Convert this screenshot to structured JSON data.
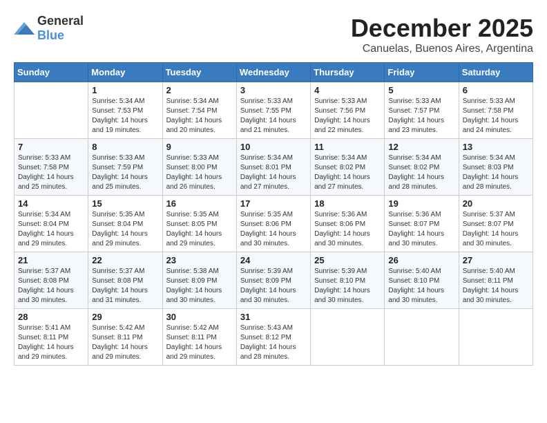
{
  "logo": {
    "general": "General",
    "blue": "Blue"
  },
  "header": {
    "month": "December 2025",
    "location": "Canuelas, Buenos Aires, Argentina"
  },
  "days_of_week": [
    "Sunday",
    "Monday",
    "Tuesday",
    "Wednesday",
    "Thursday",
    "Friday",
    "Saturday"
  ],
  "weeks": [
    [
      {
        "day": "",
        "info": ""
      },
      {
        "day": "1",
        "info": "Sunrise: 5:34 AM\nSunset: 7:53 PM\nDaylight: 14 hours\nand 19 minutes."
      },
      {
        "day": "2",
        "info": "Sunrise: 5:34 AM\nSunset: 7:54 PM\nDaylight: 14 hours\nand 20 minutes."
      },
      {
        "day": "3",
        "info": "Sunrise: 5:33 AM\nSunset: 7:55 PM\nDaylight: 14 hours\nand 21 minutes."
      },
      {
        "day": "4",
        "info": "Sunrise: 5:33 AM\nSunset: 7:56 PM\nDaylight: 14 hours\nand 22 minutes."
      },
      {
        "day": "5",
        "info": "Sunrise: 5:33 AM\nSunset: 7:57 PM\nDaylight: 14 hours\nand 23 minutes."
      },
      {
        "day": "6",
        "info": "Sunrise: 5:33 AM\nSunset: 7:58 PM\nDaylight: 14 hours\nand 24 minutes."
      }
    ],
    [
      {
        "day": "7",
        "info": "Sunrise: 5:33 AM\nSunset: 7:58 PM\nDaylight: 14 hours\nand 25 minutes."
      },
      {
        "day": "8",
        "info": "Sunrise: 5:33 AM\nSunset: 7:59 PM\nDaylight: 14 hours\nand 25 minutes."
      },
      {
        "day": "9",
        "info": "Sunrise: 5:33 AM\nSunset: 8:00 PM\nDaylight: 14 hours\nand 26 minutes."
      },
      {
        "day": "10",
        "info": "Sunrise: 5:34 AM\nSunset: 8:01 PM\nDaylight: 14 hours\nand 27 minutes."
      },
      {
        "day": "11",
        "info": "Sunrise: 5:34 AM\nSunset: 8:02 PM\nDaylight: 14 hours\nand 27 minutes."
      },
      {
        "day": "12",
        "info": "Sunrise: 5:34 AM\nSunset: 8:02 PM\nDaylight: 14 hours\nand 28 minutes."
      },
      {
        "day": "13",
        "info": "Sunrise: 5:34 AM\nSunset: 8:03 PM\nDaylight: 14 hours\nand 28 minutes."
      }
    ],
    [
      {
        "day": "14",
        "info": "Sunrise: 5:34 AM\nSunset: 8:04 PM\nDaylight: 14 hours\nand 29 minutes."
      },
      {
        "day": "15",
        "info": "Sunrise: 5:35 AM\nSunset: 8:04 PM\nDaylight: 14 hours\nand 29 minutes."
      },
      {
        "day": "16",
        "info": "Sunrise: 5:35 AM\nSunset: 8:05 PM\nDaylight: 14 hours\nand 29 minutes."
      },
      {
        "day": "17",
        "info": "Sunrise: 5:35 AM\nSunset: 8:06 PM\nDaylight: 14 hours\nand 30 minutes."
      },
      {
        "day": "18",
        "info": "Sunrise: 5:36 AM\nSunset: 8:06 PM\nDaylight: 14 hours\nand 30 minutes."
      },
      {
        "day": "19",
        "info": "Sunrise: 5:36 AM\nSunset: 8:07 PM\nDaylight: 14 hours\nand 30 minutes."
      },
      {
        "day": "20",
        "info": "Sunrise: 5:37 AM\nSunset: 8:07 PM\nDaylight: 14 hours\nand 30 minutes."
      }
    ],
    [
      {
        "day": "21",
        "info": "Sunrise: 5:37 AM\nSunset: 8:08 PM\nDaylight: 14 hours\nand 30 minutes."
      },
      {
        "day": "22",
        "info": "Sunrise: 5:37 AM\nSunset: 8:08 PM\nDaylight: 14 hours\nand 31 minutes."
      },
      {
        "day": "23",
        "info": "Sunrise: 5:38 AM\nSunset: 8:09 PM\nDaylight: 14 hours\nand 30 minutes."
      },
      {
        "day": "24",
        "info": "Sunrise: 5:39 AM\nSunset: 8:09 PM\nDaylight: 14 hours\nand 30 minutes."
      },
      {
        "day": "25",
        "info": "Sunrise: 5:39 AM\nSunset: 8:10 PM\nDaylight: 14 hours\nand 30 minutes."
      },
      {
        "day": "26",
        "info": "Sunrise: 5:40 AM\nSunset: 8:10 PM\nDaylight: 14 hours\nand 30 minutes."
      },
      {
        "day": "27",
        "info": "Sunrise: 5:40 AM\nSunset: 8:11 PM\nDaylight: 14 hours\nand 30 minutes."
      }
    ],
    [
      {
        "day": "28",
        "info": "Sunrise: 5:41 AM\nSunset: 8:11 PM\nDaylight: 14 hours\nand 29 minutes."
      },
      {
        "day": "29",
        "info": "Sunrise: 5:42 AM\nSunset: 8:11 PM\nDaylight: 14 hours\nand 29 minutes."
      },
      {
        "day": "30",
        "info": "Sunrise: 5:42 AM\nSunset: 8:11 PM\nDaylight: 14 hours\nand 29 minutes."
      },
      {
        "day": "31",
        "info": "Sunrise: 5:43 AM\nSunset: 8:12 PM\nDaylight: 14 hours\nand 28 minutes."
      },
      {
        "day": "",
        "info": ""
      },
      {
        "day": "",
        "info": ""
      },
      {
        "day": "",
        "info": ""
      }
    ]
  ]
}
